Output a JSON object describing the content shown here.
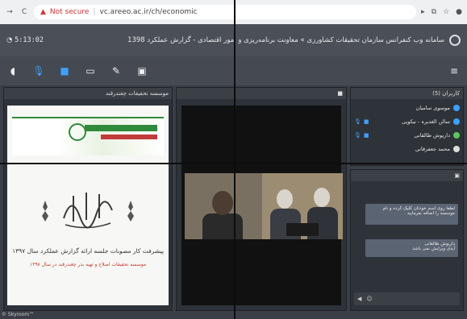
{
  "browser": {
    "security_label": "Not secure",
    "url": "vc.areeo.ac.ir/ch/economic"
  },
  "header": {
    "timer": "5:13:02",
    "title": "سامانه وب کنفرانس سازمان تحقیقات کشاورزی » معاونت برنامه‌ریزی و امور اقتصادی - گزارش عملکرد 1398"
  },
  "panels": {
    "document": {
      "title": "موسسه تحقیقات چغندرقند",
      "line1": "پیشرفت کار مصوبات جلسه ارائه گزارش عملکرد سال ۱۳۹۷",
      "line2": "موسسه تحقیقات اصلاح و تهیه بذر چغندرقند در سال ۱۳۹۸"
    },
    "users": {
      "title": "کاربران (5)",
      "items": [
        {
          "name": "موسوی سامیان",
          "color": "blue"
        },
        {
          "name": "سالن الغدیره - نیکویی",
          "color": "blue"
        },
        {
          "name": "داریوش طالقانی",
          "color": "green"
        },
        {
          "name": "محمد جعفرقانی",
          "color": "white"
        }
      ]
    },
    "chat": {
      "msg1": "لطفا روی اسم خودتان کلیک کرده و نام موسسه را اضافه بفرمایید",
      "msg2_name": "داریوش طالقانی",
      "msg2_text": "آیدی ویرایش نمی باشد"
    }
  },
  "footer": "© Skyroom™",
  "colors": {
    "accent": "#3ea0ff",
    "brand_green": "#2f8a3b",
    "warning_red": "#d33333"
  }
}
